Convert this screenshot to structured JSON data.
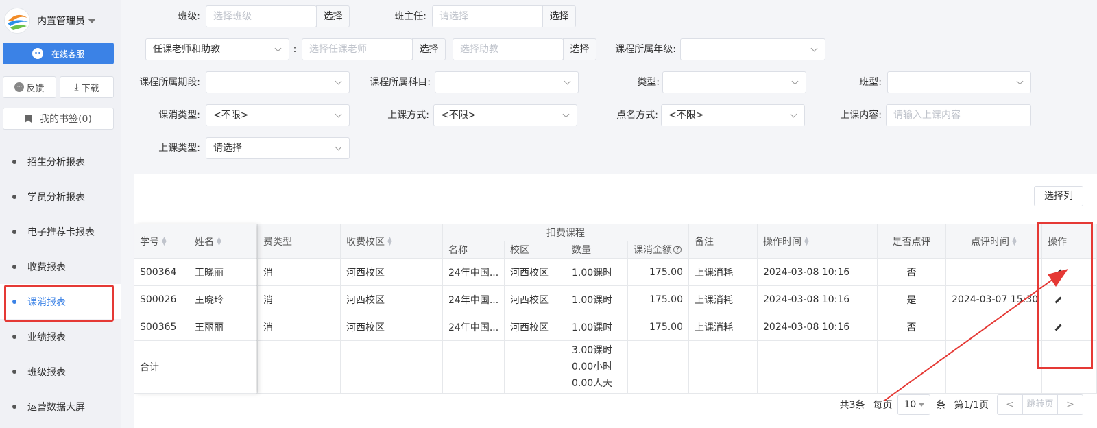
{
  "user": {
    "name": "内置管理员"
  },
  "sidebar": {
    "service_label": "在线客服",
    "feedback_label": "反馈",
    "download_label": "下载",
    "bookmark_label": "我的书签(0)",
    "nav": [
      {
        "label": "招生分析报表"
      },
      {
        "label": "学员分析报表"
      },
      {
        "label": "电子推荐卡报表"
      },
      {
        "label": "收费报表"
      },
      {
        "label": "课消报表"
      },
      {
        "label": "业绩报表"
      },
      {
        "label": "班级报表"
      },
      {
        "label": "运营数据大屏"
      }
    ]
  },
  "filter": {
    "class_label": "班级:",
    "class_ph": "选择班级",
    "choose": "选择",
    "teacher_label": "班主任:",
    "teacher_ph": "请选择",
    "teacher_assist_sel": "任课老师和助教",
    "colon": ":",
    "assign_teacher_ph": "选择任课老师",
    "assistant_ph": "选择助教",
    "grade_label": "课程所属年级:",
    "period_label": "课程所属期段:",
    "subject_label": "课程所属科目:",
    "type_label": "类型:",
    "class_type_label": "班型:",
    "consume_type_label": "课消类型:",
    "consume_type_val": "<不限>",
    "mode_label": "上课方式:",
    "mode_val": "<不限>",
    "rollcall_label": "点名方式:",
    "rollcall_val": "<不限>",
    "content_label": "上课内容:",
    "content_ph": "请输入上课内容",
    "lesson_type_label": "上课类型:",
    "lesson_type_val": "请选择"
  },
  "toolbar": {
    "choose_col": "选择列"
  },
  "table": {
    "headers": {
      "student_no": "学号",
      "name": "姓名",
      "fee_type": "费类型",
      "campus": "收费校区",
      "deduct_course": "扣费课程",
      "course_name": "名称",
      "course_campus": "校区",
      "quantity": "数量",
      "amount": "课消金额",
      "remark": "备注",
      "op_time": "操作时间",
      "commented": "是否点评",
      "comment_time": "点评时间",
      "action": "操作"
    },
    "rows": [
      {
        "no": "S00364",
        "name": "王晓丽",
        "fee": "消",
        "campus": "河西校区",
        "course": "24年中国...",
        "ccampus": "河西校区",
        "qty": "1.00课时",
        "amount": "175.00",
        "remark": "上课消耗",
        "time": "2024-03-08 10:16",
        "commented": "否",
        "ctime": ""
      },
      {
        "no": "S00026",
        "name": "王晓玲",
        "fee": "消",
        "campus": "河西校区",
        "course": "24年中国...",
        "ccampus": "河西校区",
        "qty": "1.00课时",
        "amount": "175.00",
        "remark": "上课消耗",
        "time": "2024-03-08 10:16",
        "commented": "是",
        "ctime": "2024-03-07 15:30"
      },
      {
        "no": "S00365",
        "name": "王丽丽",
        "fee": "消",
        "campus": "河西校区",
        "course": "24年中国...",
        "ccampus": "河西校区",
        "qty": "1.00课时",
        "amount": "175.00",
        "remark": "上课消耗",
        "time": "2024-03-08 10:16",
        "commented": "否",
        "ctime": ""
      }
    ],
    "total": {
      "label": "合计",
      "q1": "3.00课时",
      "q2": "0.00小时",
      "q3": "0.00人天"
    }
  },
  "pager": {
    "total": "共3条",
    "per_page": "每页",
    "size": "10",
    "unit": "条",
    "page": "第1/1页",
    "jump": "跳转页",
    "prev": "<",
    "next": ">"
  }
}
